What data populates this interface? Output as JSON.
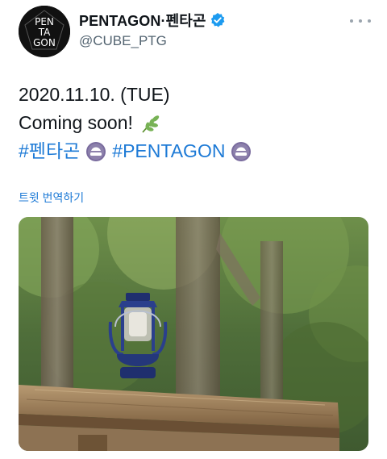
{
  "author": {
    "display_name": "PENTAGON·펜타곤",
    "handle": "@CUBE_PTG",
    "avatar_text": [
      "PEN",
      "TA",
      "GON"
    ],
    "verified": true
  },
  "tweet": {
    "line1": "2020.11.10. (TUE)",
    "line2": "Coming soon!",
    "hashtag1": "#펜타곤",
    "hashtag2": "#PENTAGON",
    "translate_link": "트윗 번역하기"
  },
  "icons": {
    "verified": "verified-badge-icon",
    "more": "more-options-icon",
    "leaf": "herb-leaf-emoji-icon",
    "hashtag_badge": "pentagon-hashflag-icon"
  },
  "colors": {
    "link": "#1d7ad6",
    "verified": "#1d9bf0",
    "secondary_text": "#536471"
  },
  "media": {
    "description_icon": "lantern-on-wooden-table-photo"
  }
}
